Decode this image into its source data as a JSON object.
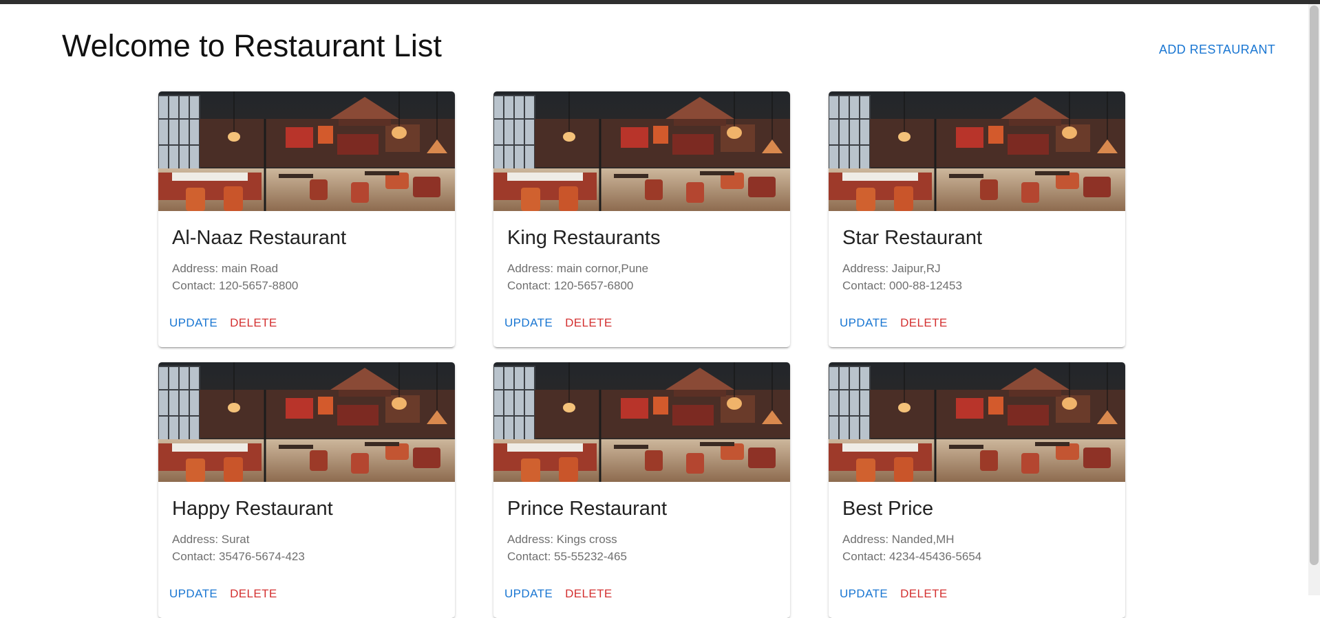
{
  "header": {
    "title": "Welcome to Restaurant List",
    "add_label": "ADD RESTAURANT"
  },
  "colors": {
    "primary": "#1976d2",
    "danger": "#d32f2f",
    "text_muted": "#6f6f6f"
  },
  "cards": [
    {
      "name": "Al-Naaz Restaurant",
      "address": "Address: main Road",
      "contact": "Contact: 120-5657-8800",
      "update_label": "UPDATE",
      "delete_label": "DELETE"
    },
    {
      "name": "King Restaurants",
      "address": "Address: main cornor,Pune",
      "contact": "Contact: 120-5657-6800",
      "update_label": "UPDATE",
      "delete_label": "DELETE"
    },
    {
      "name": "Star Restaurant",
      "address": "Address: Jaipur,RJ",
      "contact": "Contact: 000-88-12453",
      "update_label": "UPDATE",
      "delete_label": "DELETE"
    },
    {
      "name": "Happy Restaurant",
      "address": "Address: Surat",
      "contact": "Contact: 35476-5674-423",
      "update_label": "UPDATE",
      "delete_label": "DELETE"
    },
    {
      "name": "Prince Restaurant",
      "address": "Address: Kings cross",
      "contact": "Contact: 55-55232-465",
      "update_label": "UPDATE",
      "delete_label": "DELETE"
    },
    {
      "name": "Best Price",
      "address": "Address: Nanded,MH",
      "contact": "Contact: 4234-45436-5654",
      "update_label": "UPDATE",
      "delete_label": "DELETE"
    }
  ]
}
